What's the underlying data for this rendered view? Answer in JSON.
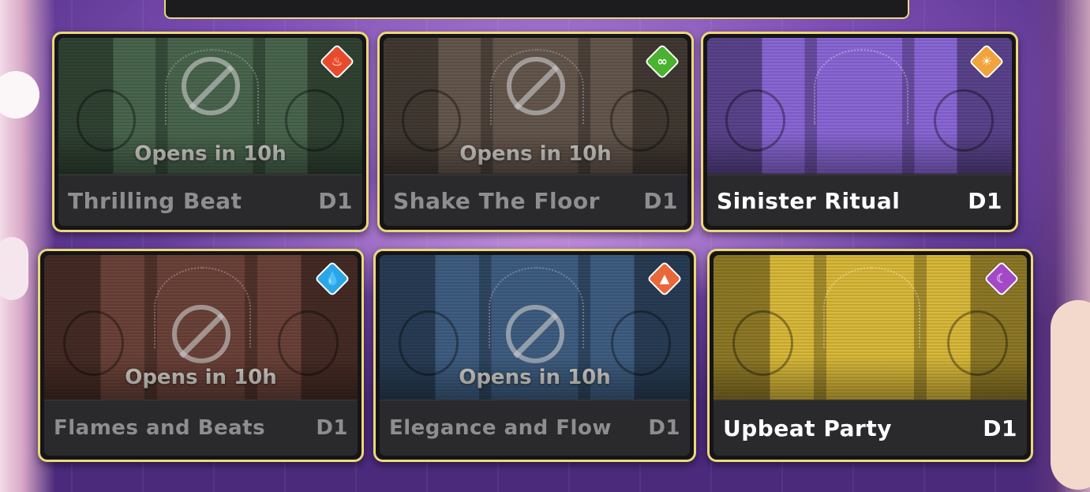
{
  "cards": [
    {
      "title": "Thrilling Beat",
      "difficulty": "D1",
      "status": "Opens in 10h",
      "locked": true,
      "element": "fire-icon",
      "element_color": "#e84b2c",
      "stage_color": "#4e7a55"
    },
    {
      "title": "Shake The Floor",
      "difficulty": "D1",
      "status": "Opens in 10h",
      "locked": true,
      "element": "wind-icon",
      "element_color": "#49b22f",
      "stage_color": "#7a6556"
    },
    {
      "title": "Sinister Ritual",
      "difficulty": "D1",
      "status": "",
      "locked": false,
      "element": "light-icon",
      "element_color": "#f1a43c",
      "stage_color": "#8a67d6"
    },
    {
      "title": "Flames and Beats",
      "difficulty": "D1",
      "status": "Opens in 10h",
      "locked": true,
      "element": "water-icon",
      "element_color": "#2aa6e8",
      "stage_color": "#8a4a3c"
    },
    {
      "title": "Elegance and Flow",
      "difficulty": "D1",
      "status": "Opens in 10h",
      "locked": true,
      "element": "earth-icon",
      "element_color": "#e8683a",
      "stage_color": "#3e6fa8"
    },
    {
      "title": "Upbeat Party",
      "difficulty": "D1",
      "status": "",
      "locked": false,
      "element": "dark-icon",
      "element_color": "#a449c6",
      "stage_color": "#d9b93a"
    }
  ]
}
